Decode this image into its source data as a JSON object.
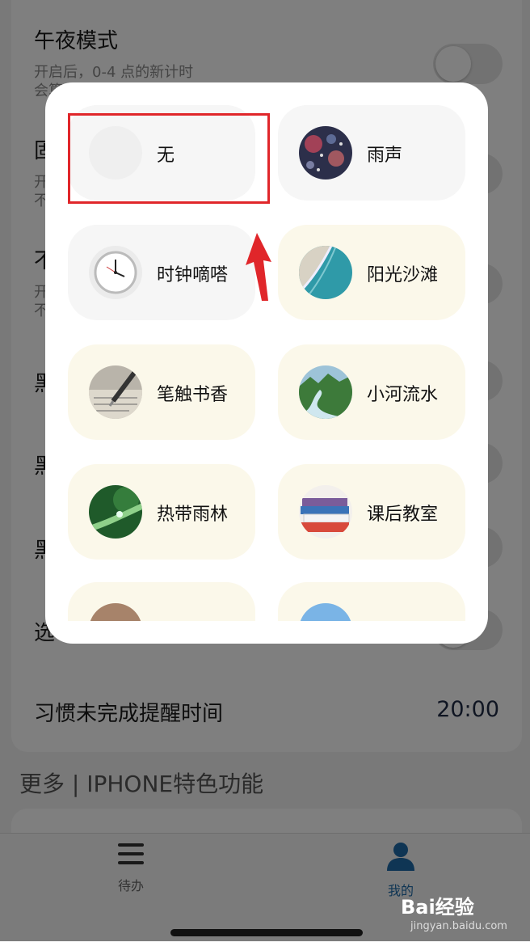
{
  "settings": {
    "midnight_title": "午夜模式",
    "midnight_desc_1": "开启后，0-4 点的新计时",
    "midnight_desc_2": "会算",
    "row2_initial": "固",
    "row2_desc_1": "开",
    "row2_desc_2": "不",
    "row3_initial": "不",
    "row3_desc_1": "开",
    "row3_desc_2": "不",
    "row4_initial": "黑",
    "row5_initial": "黑",
    "row6_initial": "黑",
    "row7_initial": "选",
    "reminder_title": "习惯未完成提醒时间",
    "reminder_time": "20:00",
    "more_section": "更多 | IPHONE特色功能"
  },
  "tabbar": {
    "todo_label": "待办",
    "mine_label": "我的",
    "active_color": "#1e6aa8"
  },
  "modal": {
    "sounds": [
      {
        "label": "无",
        "thumb": "blank-icon"
      },
      {
        "label": "雨声",
        "thumb": "rain-image"
      },
      {
        "label": "时钟嘀嗒",
        "thumb": "clock-image"
      },
      {
        "label": "阳光沙滩",
        "thumb": "beach-image"
      },
      {
        "label": "笔触书香",
        "thumb": "pen-image"
      },
      {
        "label": "小河流水",
        "thumb": "river-image"
      },
      {
        "label": "热带雨林",
        "thumb": "rainforest-image"
      },
      {
        "label": "课后教室",
        "thumb": "books-image"
      }
    ]
  },
  "annotation_color": "#e0262a",
  "watermark": {
    "brand": "Bai经验",
    "url": "jingyan.baidu.com"
  }
}
